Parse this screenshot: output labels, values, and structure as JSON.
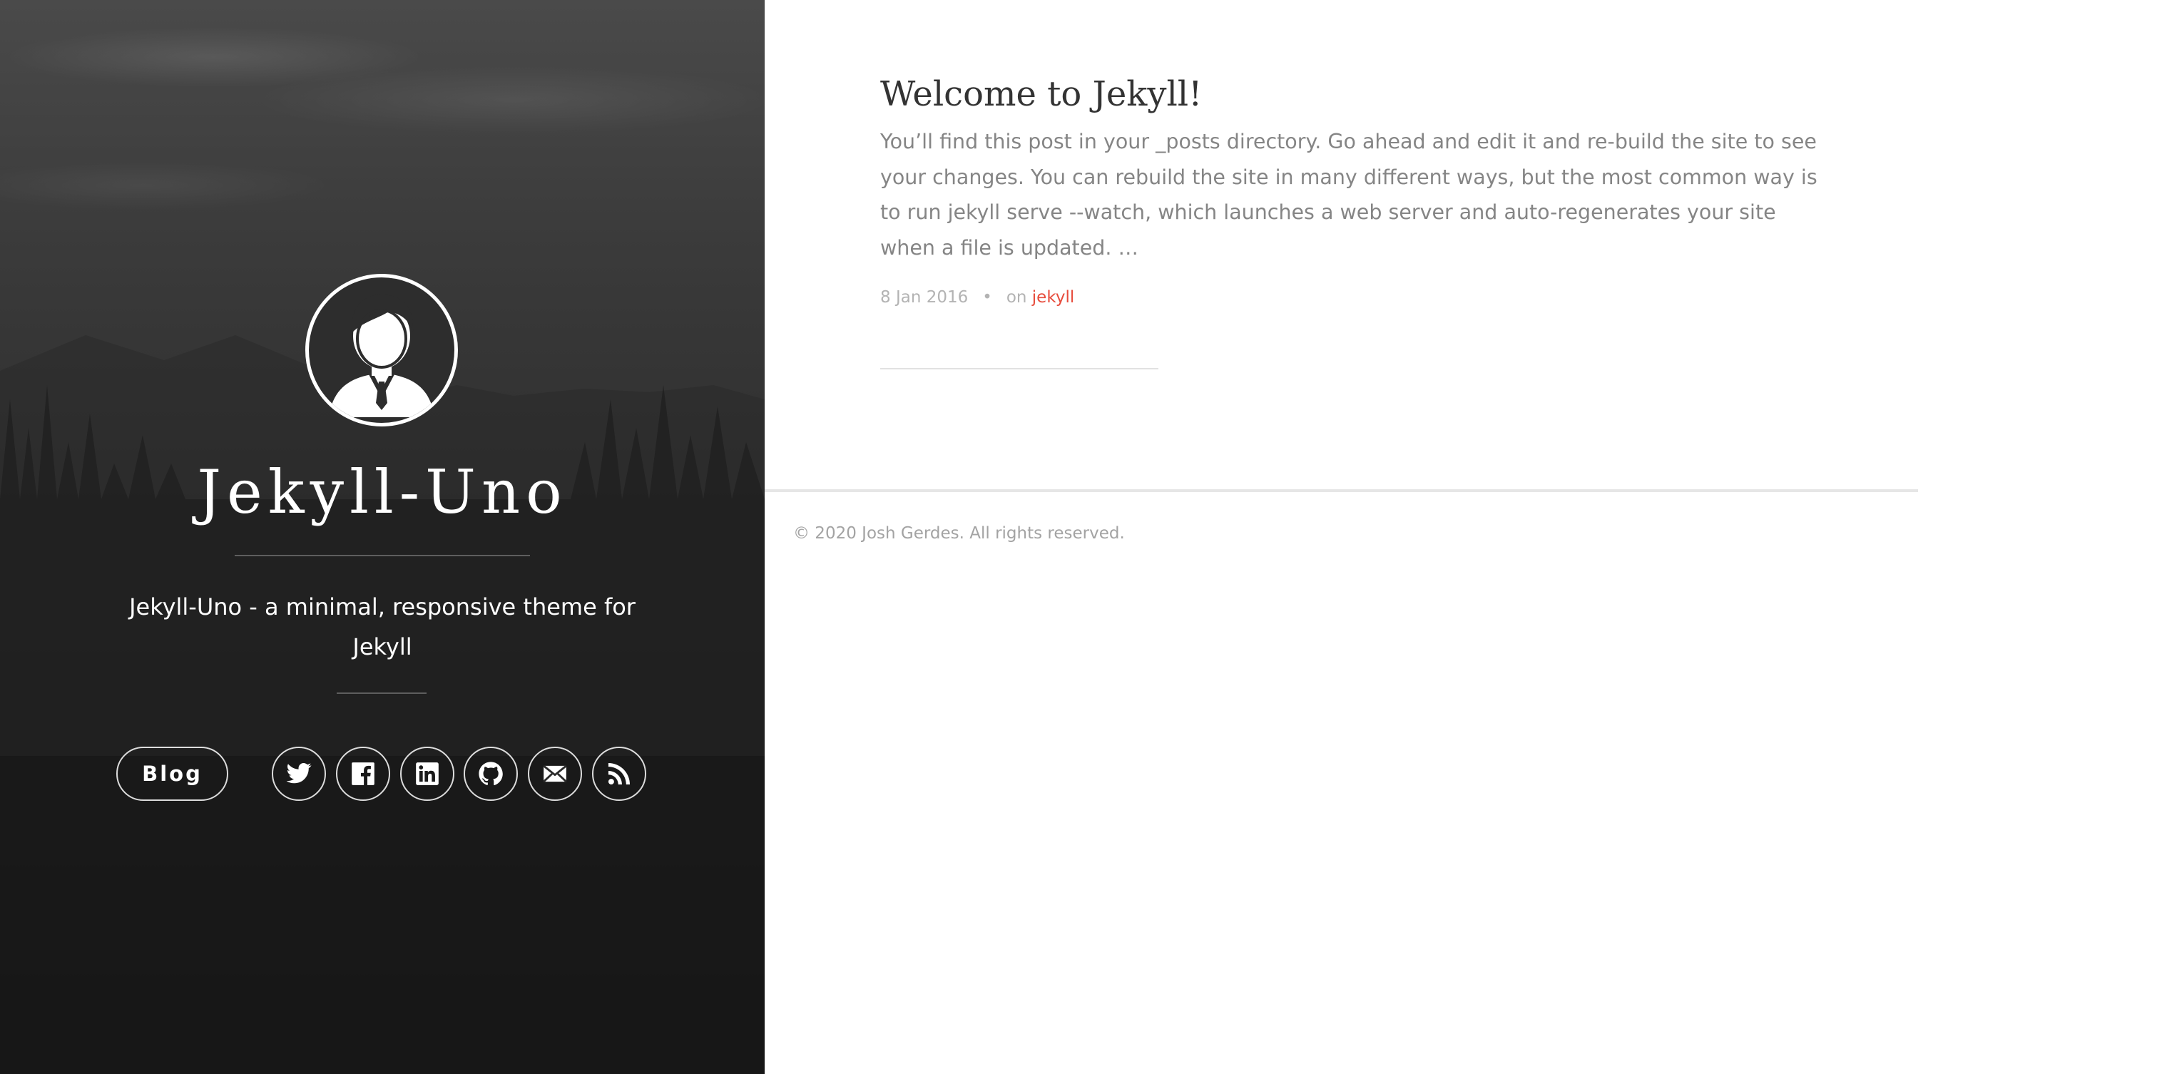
{
  "sidebar": {
    "avatar_alt": "avatar",
    "title": "Jekyll-Uno",
    "tagline": "Jekyll-Uno - a minimal, responsive theme for Jekyll",
    "nav": {
      "blog_label": "Blog"
    },
    "social": [
      {
        "name": "twitter-icon"
      },
      {
        "name": "facebook-icon"
      },
      {
        "name": "linkedin-icon"
      },
      {
        "name": "github-icon"
      },
      {
        "name": "email-icon"
      },
      {
        "name": "rss-icon"
      }
    ]
  },
  "post": {
    "title": "Welcome to Jekyll!",
    "excerpt": "You’ll find this post in your _posts directory. Go ahead and edit it and re-build the site to see your changes. You can rebuild the site in many different ways, but the most common way is to run jekyll serve --watch, which launches a web server and auto-regenerates your site when a file is updated. …",
    "date": "8 Jan 2016",
    "separator": "•",
    "on_label": "on",
    "tag": "jekyll"
  },
  "footer": {
    "copyright": "© 2020 Josh Gerdes. All rights reserved."
  },
  "colors": {
    "accent": "#e74c3c",
    "body_text": "#858585",
    "title_text": "#333333"
  }
}
